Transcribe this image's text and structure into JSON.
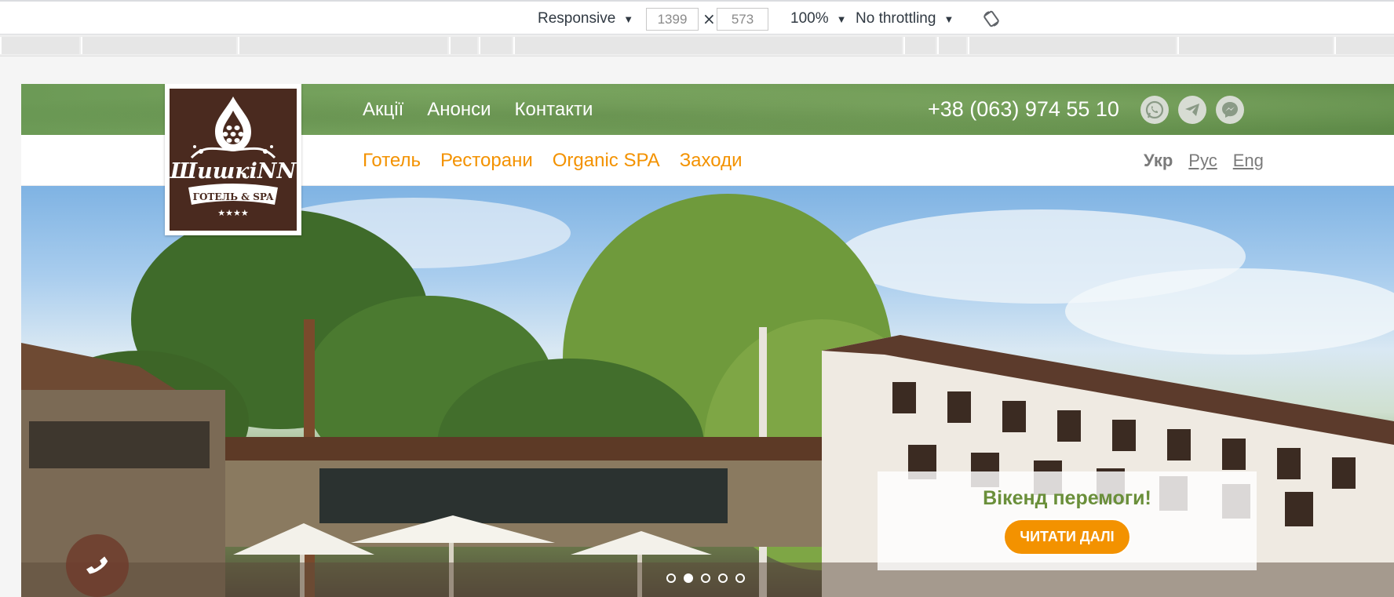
{
  "devtools": {
    "device_label": "Responsive",
    "width_value": "1399",
    "height_value": "573",
    "times": "×",
    "zoom_label": "100%",
    "throttling_label": "No throttling",
    "arrow": "▼",
    "rotate_icon": "rotate-icon"
  },
  "site": {
    "top_nav": [
      "Акції",
      "Анонси",
      "Контакти"
    ],
    "phone": "+38 (063) 974 55 10",
    "social_icons": [
      "whatsapp-icon",
      "telegram-icon",
      "messenger-icon"
    ],
    "main_nav": [
      "Готель",
      "Ресторани",
      "Organic SPA",
      "Заходи"
    ],
    "languages": {
      "active": "Укр",
      "others": [
        "Рус",
        "Eng"
      ]
    },
    "logo": {
      "name": "ШишкіNN",
      "subtitle": "ГОТЕЛЬ & SPA",
      "stars": "★★★★"
    },
    "promo": {
      "title": "Вікенд перемоги!",
      "button": "ЧИТАТИ ДАЛІ"
    },
    "slider": {
      "count": 5,
      "active_index": 1
    },
    "colors": {
      "accent": "#f39200",
      "topbar_green": "#6c9a56",
      "logo_brown": "#4a2a1f",
      "promo_title": "#6a8f3a"
    }
  }
}
